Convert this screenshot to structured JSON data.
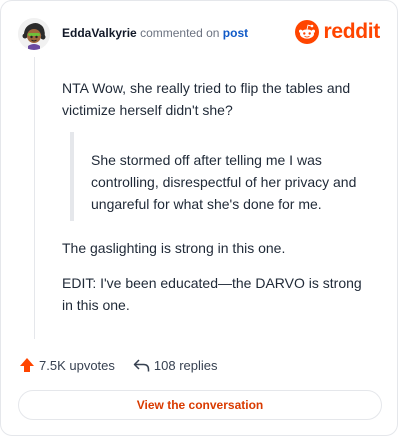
{
  "header": {
    "username": "EddaValkyrie",
    "action_text": "commented on",
    "post_link": "post",
    "logo_text": "reddit"
  },
  "comment": {
    "paragraph_1": "NTA Wow, she really tried to flip the tables and victimize herself didn't she?",
    "quote": "She stormed off after telling me I was controlling, disrespectful of her privacy and ungareful for what she's done for me.",
    "paragraph_2": "The gaslighting is strong in this one.",
    "paragraph_3": "EDIT: I've been educated—the DARVO is strong in this one."
  },
  "stats": {
    "upvotes": "7.5K upvotes",
    "replies": "108 replies"
  },
  "cta": {
    "label": "View the conversation"
  },
  "icons": {
    "avatar": "avatar",
    "logo": "reddit-alien-icon",
    "upvote": "upvote-arrow-icon",
    "reply": "reply-arrow-icon"
  },
  "colors": {
    "accent": "#ff4500",
    "cta": "#d93a00",
    "link": "#0f59c7"
  }
}
